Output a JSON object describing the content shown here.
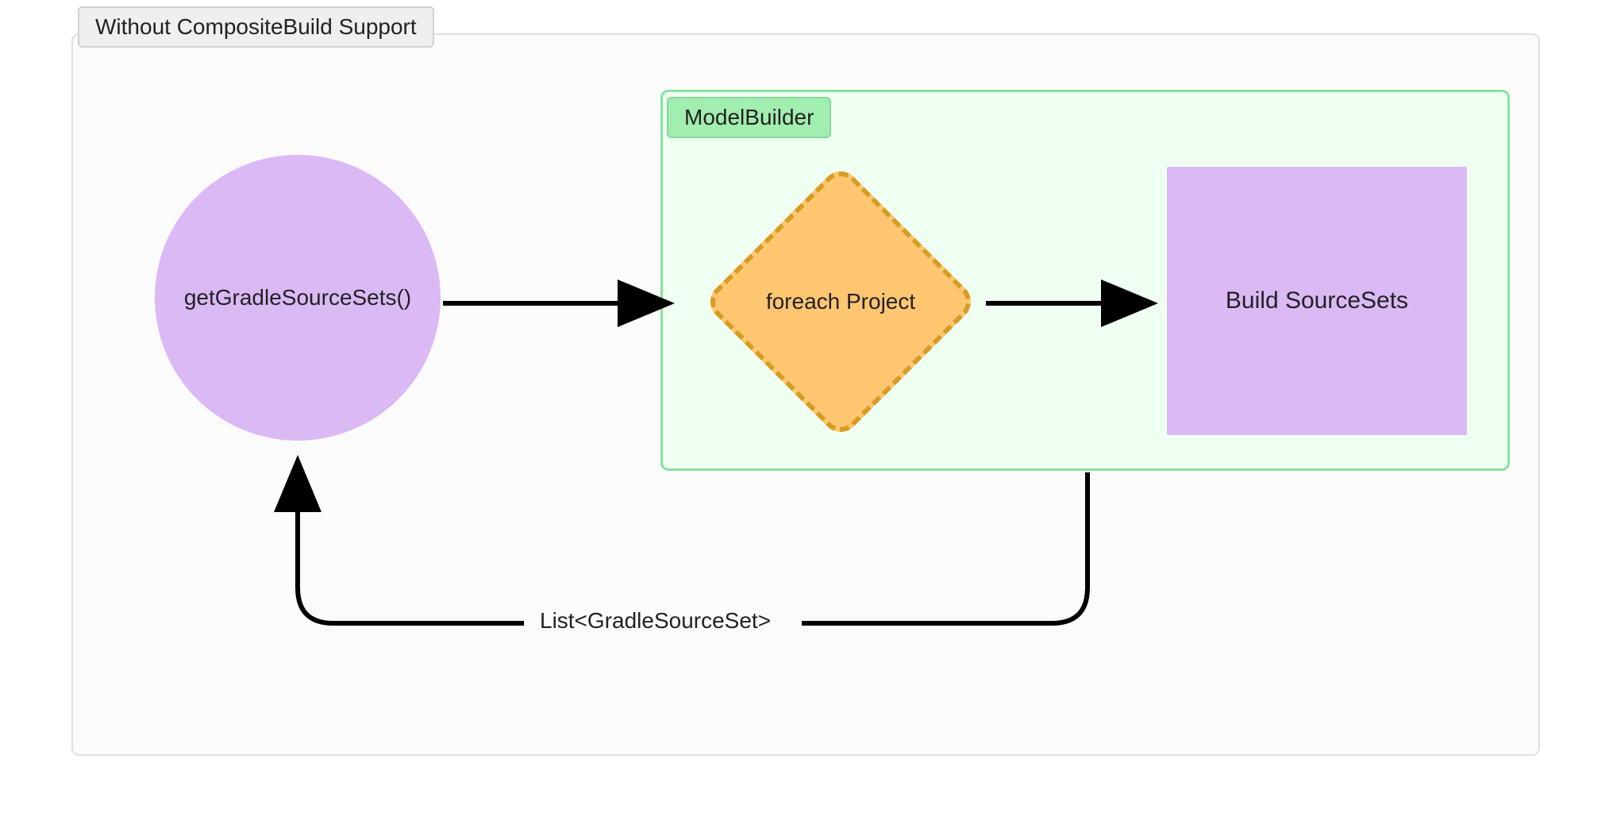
{
  "outerContainer": {
    "label": "Without CompositeBuild Support"
  },
  "circleNode": {
    "text": "getGradleSourceSets()"
  },
  "modelBuilder": {
    "label": "ModelBuilder",
    "diamondText": "foreach Project",
    "rectText": "Build SourceSets"
  },
  "returnArrow": {
    "label": "List<GradleSourceSet>"
  }
}
